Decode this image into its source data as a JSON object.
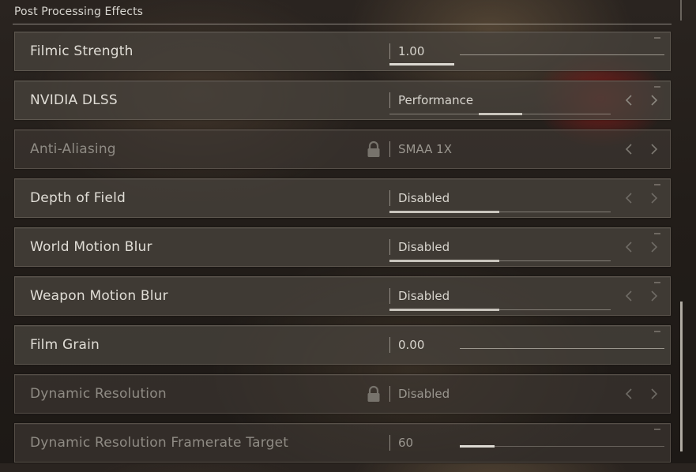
{
  "section": {
    "title": "Post Processing Effects"
  },
  "rows": [
    {
      "label": "Filmic Strength",
      "value": "1.00",
      "control": "slider",
      "slider_fraction": 0.0
    },
    {
      "label": "NVIDIA DLSS",
      "value": "Performance",
      "control": "selector",
      "locked": false
    },
    {
      "label": "Anti-Aliasing",
      "value": "SMAA 1X",
      "control": "selector",
      "locked": true
    },
    {
      "label": "Depth of Field",
      "value": "Disabled",
      "control": "selector",
      "locked": false
    },
    {
      "label": "World Motion Blur",
      "value": "Disabled",
      "control": "selector",
      "locked": false
    },
    {
      "label": "Weapon Motion Blur",
      "value": "Disabled",
      "control": "selector",
      "locked": false
    },
    {
      "label": "Film Grain",
      "value": "0.00",
      "control": "slider",
      "slider_fraction": 0.0
    },
    {
      "label": "Dynamic Resolution",
      "value": "Disabled",
      "control": "selector",
      "locked": true
    },
    {
      "label": "Dynamic Resolution Framerate Target",
      "value": "60",
      "control": "slider",
      "slider_fraction": 0.17,
      "disabled": true
    }
  ],
  "icons": {
    "lock": "lock-icon",
    "left_arrow": "chevron-left-icon",
    "right_arrow": "chevron-right-icon"
  },
  "colors": {
    "text_primary": "#e0ddd6",
    "text_disabled": "#8f8b84",
    "accent_fill": "#dcd9d2",
    "panel": "#48423c"
  }
}
